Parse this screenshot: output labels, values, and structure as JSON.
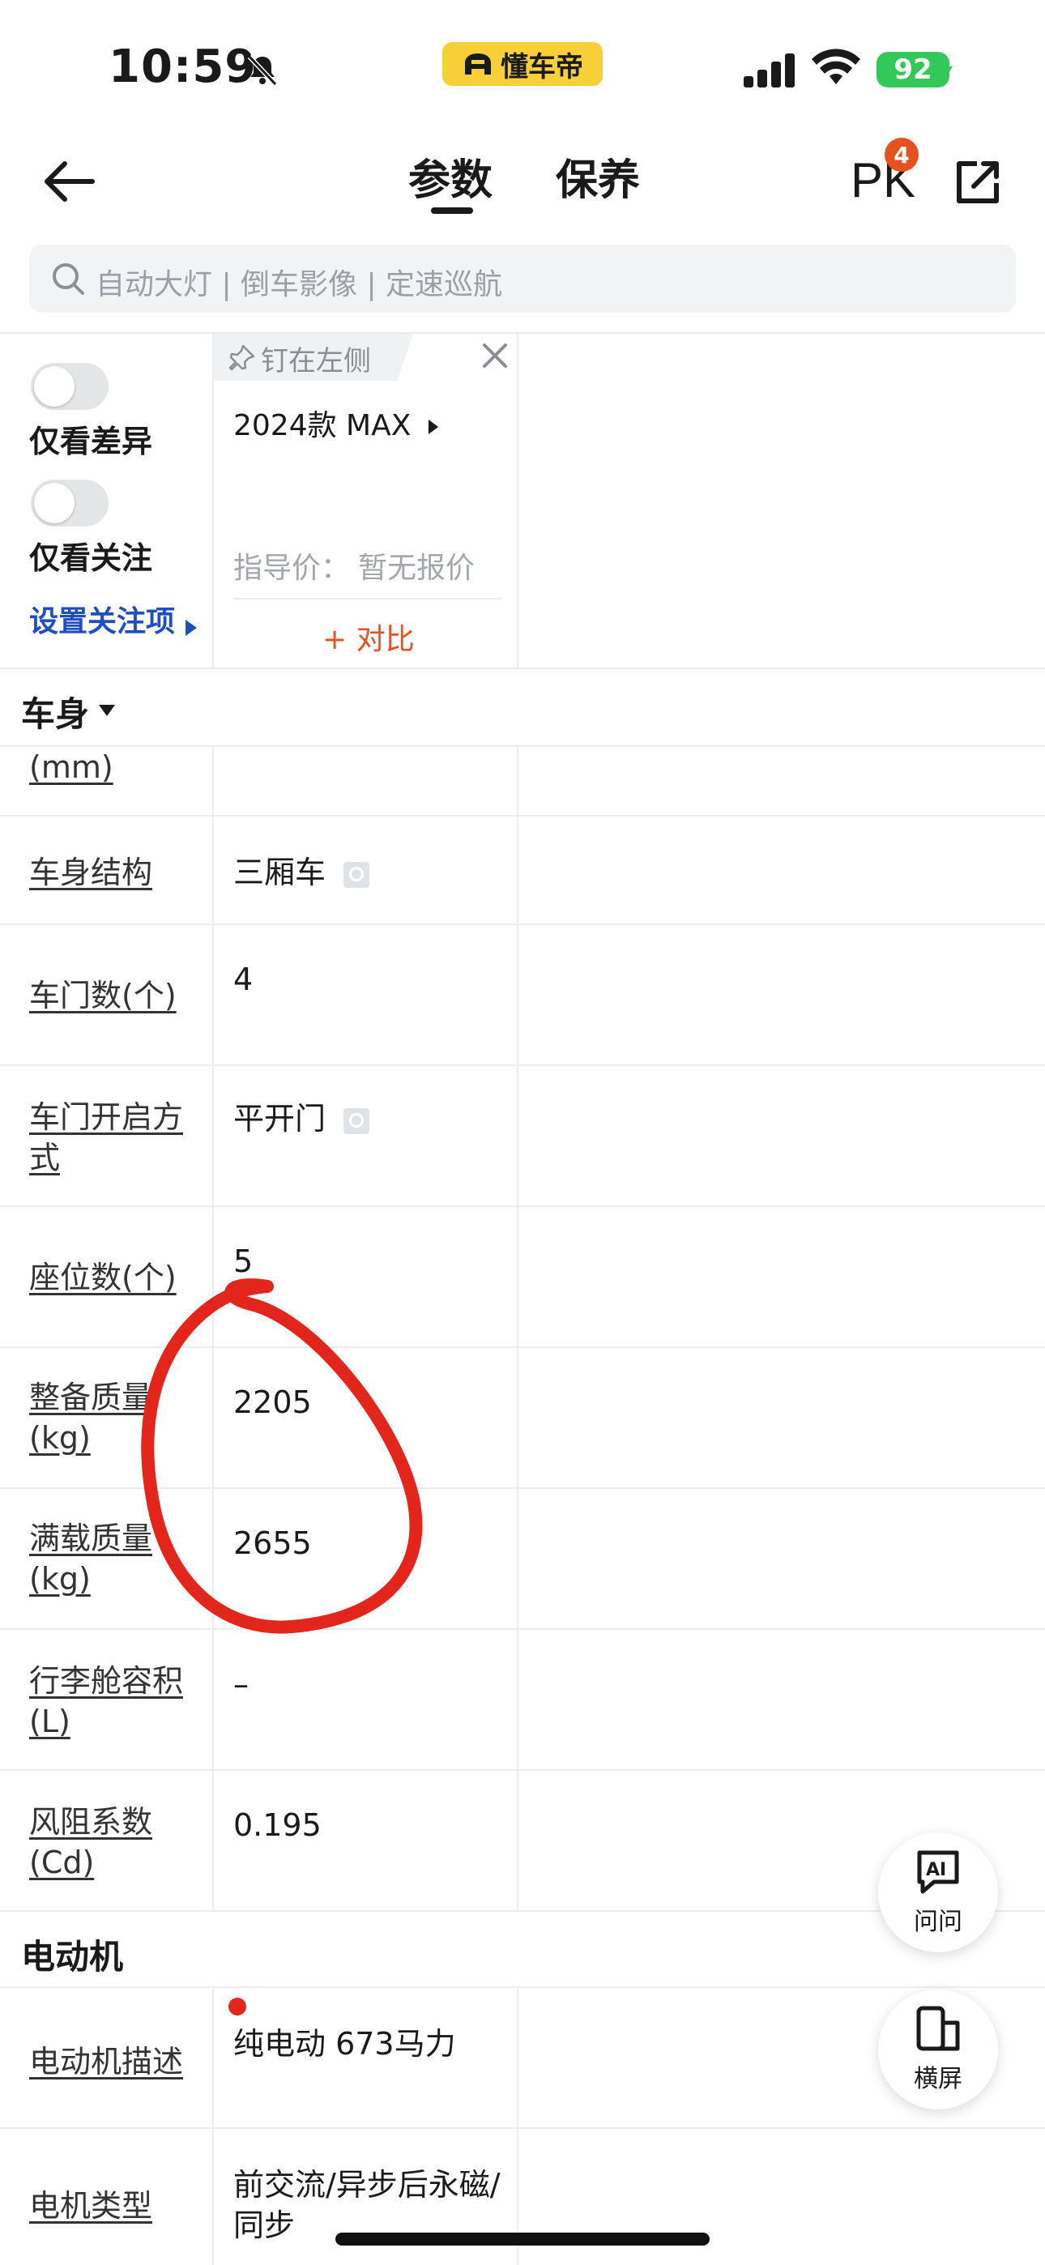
{
  "status_bar": {
    "time": "10:59",
    "app_name": "懂车帝",
    "battery": "92"
  },
  "header": {
    "tabs": [
      {
        "label": "参数",
        "active": true
      },
      {
        "label": "保养",
        "active": false
      }
    ],
    "pk_label": "PK",
    "pk_count": "4"
  },
  "search": {
    "placeholder": "自动大灯 | 倒车影像 | 定速巡航"
  },
  "filters": {
    "diff_only_label": "仅看差异",
    "focus_only_label": "仅看关注",
    "set_focus_label": "设置关注项"
  },
  "car": {
    "pin_label": "钉在左侧",
    "name": "2024款 MAX",
    "price_label": "指导价：",
    "price_value": "暂无报价",
    "add_compare": "+ 对比"
  },
  "sections": {
    "body": {
      "title": "车身"
    },
    "motor": {
      "title": "电动机"
    }
  },
  "body_rows": [
    {
      "label": "(mm)",
      "value": ""
    },
    {
      "label": "车身结构",
      "value": "三厢车"
    },
    {
      "label": "车门数(个)",
      "value": "4"
    },
    {
      "label": "车门开启方式",
      "value": "平开门"
    },
    {
      "label": "座位数(个)",
      "value": "5"
    },
    {
      "label": "整备质量(kg)",
      "value": "2205"
    },
    {
      "label": "满载质量(kg)",
      "value": "2655"
    },
    {
      "label": "行李舱容积(L)",
      "value": "–"
    },
    {
      "label": "风阻系数(Cd)",
      "value": "0.195"
    }
  ],
  "motor_rows": [
    {
      "label": "电动机描述",
      "value": "纯电动 673马力"
    },
    {
      "label": "电机类型",
      "value": "前交流/异步后永磁/同步"
    }
  ],
  "fabs": {
    "ask_label": "问问",
    "ask_icon_text": "AI",
    "landscape_label": "横屏"
  },
  "colors": {
    "accent_orange": "#e6521f",
    "link_blue": "#1f4fbf",
    "annotation_red": "#e3261b",
    "brand_yellow": "#f7d039"
  }
}
